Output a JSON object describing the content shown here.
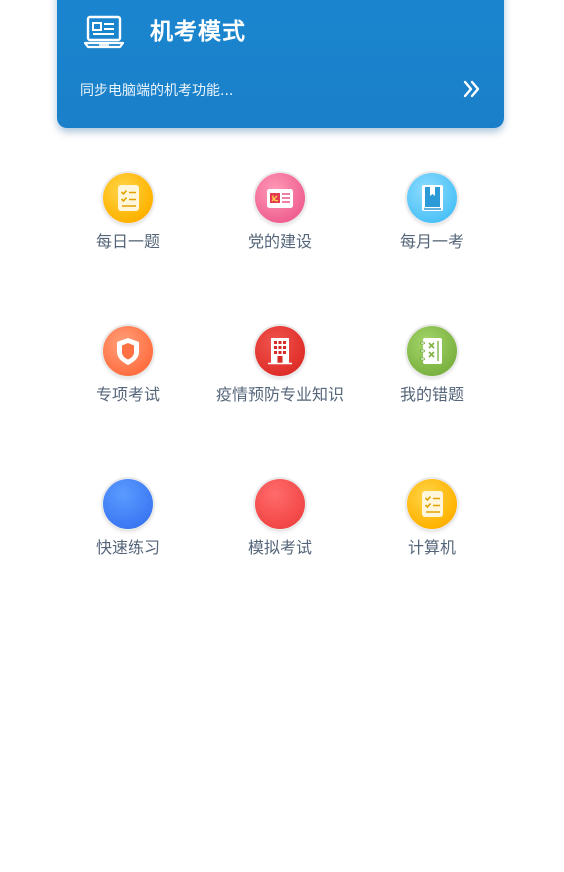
{
  "banner": {
    "title": "机考模式",
    "subtitle": "同步电脑端的机考功能...",
    "icon": "computer-icon",
    "arrow_icon": "double-chevron-right-icon"
  },
  "grid": [
    {
      "label": "每日一题",
      "icon": "checklist-icon",
      "color": "#ffb300"
    },
    {
      "label": "党的建设",
      "icon": "party-card-icon",
      "color": "#f06292"
    },
    {
      "label": "每月一考",
      "icon": "book-icon",
      "color": "#4fc3f7"
    },
    {
      "label": "专项考试",
      "icon": "shield-icon",
      "color": "#ff7043"
    },
    {
      "label": "疫情预防专业知识",
      "icon": "building-icon",
      "color": "#e53935"
    },
    {
      "label": "我的错题",
      "icon": "notebook-icon",
      "color": "#7cb342"
    },
    {
      "label": "快速练习",
      "icon": "blue-circle-icon",
      "color": "#3f7cf5"
    },
    {
      "label": "模拟考试",
      "icon": "red-circle-icon",
      "color": "#f44a4a"
    },
    {
      "label": "计算机",
      "icon": "checklist-icon",
      "color": "#ffb300"
    }
  ]
}
